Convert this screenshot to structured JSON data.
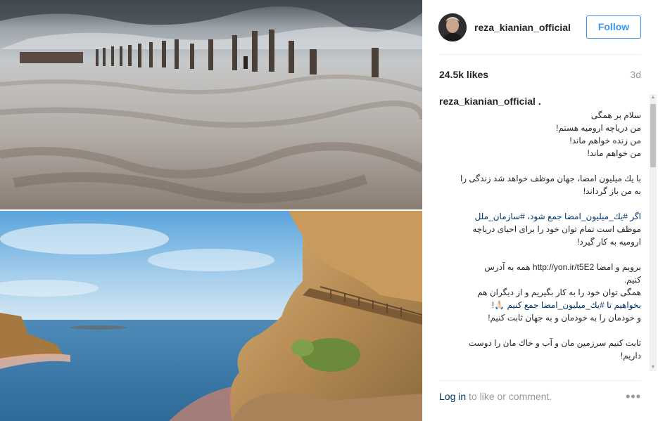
{
  "post": {
    "username": "reza_kianian_official",
    "follow_label": "Follow",
    "likes": "24.5k likes",
    "time_ago": "3d"
  },
  "caption": {
    "username": "reza_kianian_official",
    "lines": [
      "سلام بر همگی",
      "من دریاچه ارومیه هستم!",
      "من زنده خواهم ماند!",
      "من خواهم ماند!",
      "",
      "با یك میلیون امضا، جهان موظف خواهد شد زندگی را",
      "به من باز گرداند!",
      "",
      "اگر #یك_میلیون_امضا جمع شود، #سازمان_ملل",
      "موظف است تمام توان خود را برای احیای دریاچه",
      "ارومیه به کار گیرد!",
      "",
      "برویم و امضا http://yon.ir/t5E2 همه به آدرس",
      "کنیم.",
      "همگی توان خود را به کار بگیریم و از دیگران هم",
      "بخواهیم تا #یك_میلیون_امضا جمع کنیم 🙏🏻!",
      "و خودمان را به خودمان و به جهان ثابت کنیم!",
      "",
      "ثابت کنیم سرزمین مان و آب و خاك مان را دوست",
      "داریم!"
    ]
  },
  "footer": {
    "login_link": "Log in",
    "login_rest": " to like or comment.",
    "more_icon": "•••"
  },
  "icons": {
    "avatar": "avatar-icon",
    "more": "more-options-icon"
  },
  "colors": {
    "accent": "#3897f0",
    "link": "#003569",
    "muted": "#999999"
  }
}
